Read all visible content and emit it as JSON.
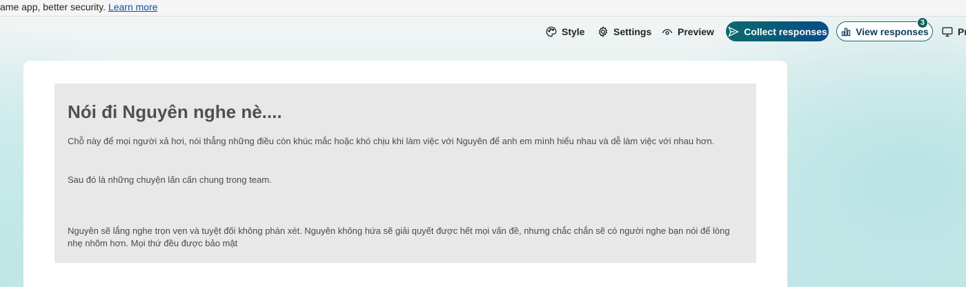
{
  "banner": {
    "text": "ame app, better security. ",
    "link": "Learn more"
  },
  "toolbar": {
    "style_label": "Style",
    "settings_label": "Settings",
    "preview_label": "Preview",
    "collect_label": "Collect responses",
    "view_label": "View responses",
    "view_badge": "3",
    "present_label": "Pr"
  },
  "form": {
    "title": "Nói đi Nguyên nghe nè....",
    "paragraphs": [
      "Chỗ này để mọi người xả hơi, nói thẳng những điều còn khúc mắc hoặc khó chịu khi làm việc với Nguyên để anh em mình hiểu nhau và dễ làm việc với nhau hơn.",
      "Sau đó là những chuyện lấn cấn chung trong team.",
      "Nguyên sẽ lắng nghe trọn vẹn và tuyệt đối không phán xét. Nguyên không hứa sẽ giải quyết được hết mọi vấn đề, nhưng chắc chắn sẽ có người nghe bạn nói để lòng nhẹ nhõm hơn. Mọi thứ đều được bảo mật"
    ]
  },
  "colors": {
    "accent": "#0b6a6a",
    "accent_end": "#064c86",
    "header_bg": "#e8e8e8"
  },
  "icons": [
    "palette-icon",
    "gear-icon",
    "eye-icon",
    "send-icon",
    "bar-chart-icon",
    "monitor-icon"
  ]
}
